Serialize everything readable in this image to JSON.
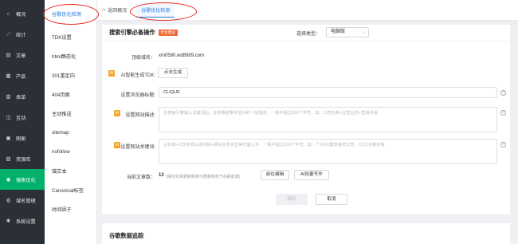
{
  "sidebar": {
    "items": [
      {
        "label": "概况",
        "icon": "home-icon"
      },
      {
        "label": "统计",
        "icon": "chart-icon"
      },
      {
        "label": "文章",
        "icon": "article-icon"
      },
      {
        "label": "产品",
        "icon": "product-icon"
      },
      {
        "label": "表单",
        "icon": "form-icon"
      },
      {
        "label": "互动",
        "icon": "interact-icon"
      },
      {
        "label": "图册",
        "icon": "album-icon"
      },
      {
        "label": "资源库",
        "icon": "resource-icon"
      },
      {
        "label": "搜索优化",
        "icon": "search-icon",
        "active": true
      },
      {
        "label": "域名管理",
        "icon": "globe-icon"
      },
      {
        "label": "系统设置",
        "icon": "gear-icon"
      }
    ]
  },
  "subnav": {
    "items": [
      {
        "label": "谷歌优化检测",
        "active": true
      },
      {
        "label": "TDK设置"
      },
      {
        "label": "html静态化"
      },
      {
        "label": "301重定向"
      },
      {
        "label": "404页面"
      },
      {
        "label": "主动推送"
      },
      {
        "label": "sitemap"
      },
      {
        "label": "nofollow"
      },
      {
        "label": "锚文本"
      },
      {
        "label": "Canonical标签"
      },
      {
        "label": "时间因子"
      }
    ]
  },
  "topbar": {
    "breadcrumb": "返回概况",
    "active_tab": "谷歌优化检测"
  },
  "main": {
    "title": "搜索引擎必备操作",
    "tag": "优化建议",
    "select_type_label": "选择类型：",
    "select_type_value": "电脑版",
    "domain_label": "顶级域名：",
    "domain_value": "xm0590.wd8989.com",
    "ai_tdk_label": "AI智能生成TDK:",
    "ai_tdk_button": "点击生成",
    "browser_title_label": "设置浏览器标题:",
    "browser_title_value": "CLIQUE",
    "description_label": "设置网站描述:",
    "description_placeholder": "在搜索引擎输入关键词后，在搜索结果中显示的一段描述，一般不超过200个字符。如：公司名称+主营业务+营销术语",
    "keywords_label": "设置网站关键词:",
    "keywords_placeholder": "从标域+公司名称以及地域+网站业务定位等方面入手，一般不超过100个字符。如：广州XX建筑装修公司，XX文化策划馆",
    "article_count_label": "当前文章数：",
    "article_count_value": "13",
    "article_count_note": "(保持文章更新频率与质量有利于谷歌收录)",
    "go_edit_button": "前往编辑",
    "ai_batch_button": "AI批量写作",
    "save_button": "保存",
    "cancel_button": "取消",
    "badge_text": "AI"
  },
  "second_card": {
    "title": "谷歌数据追踪"
  },
  "colors": {
    "sidebar_bg": "#2b2f36",
    "active_green": "#00b06b",
    "link_blue": "#1e7be6",
    "tag_orange": "#f06a35",
    "badge_yellow": "#f5a623",
    "annotation_red": "#e3271d"
  }
}
